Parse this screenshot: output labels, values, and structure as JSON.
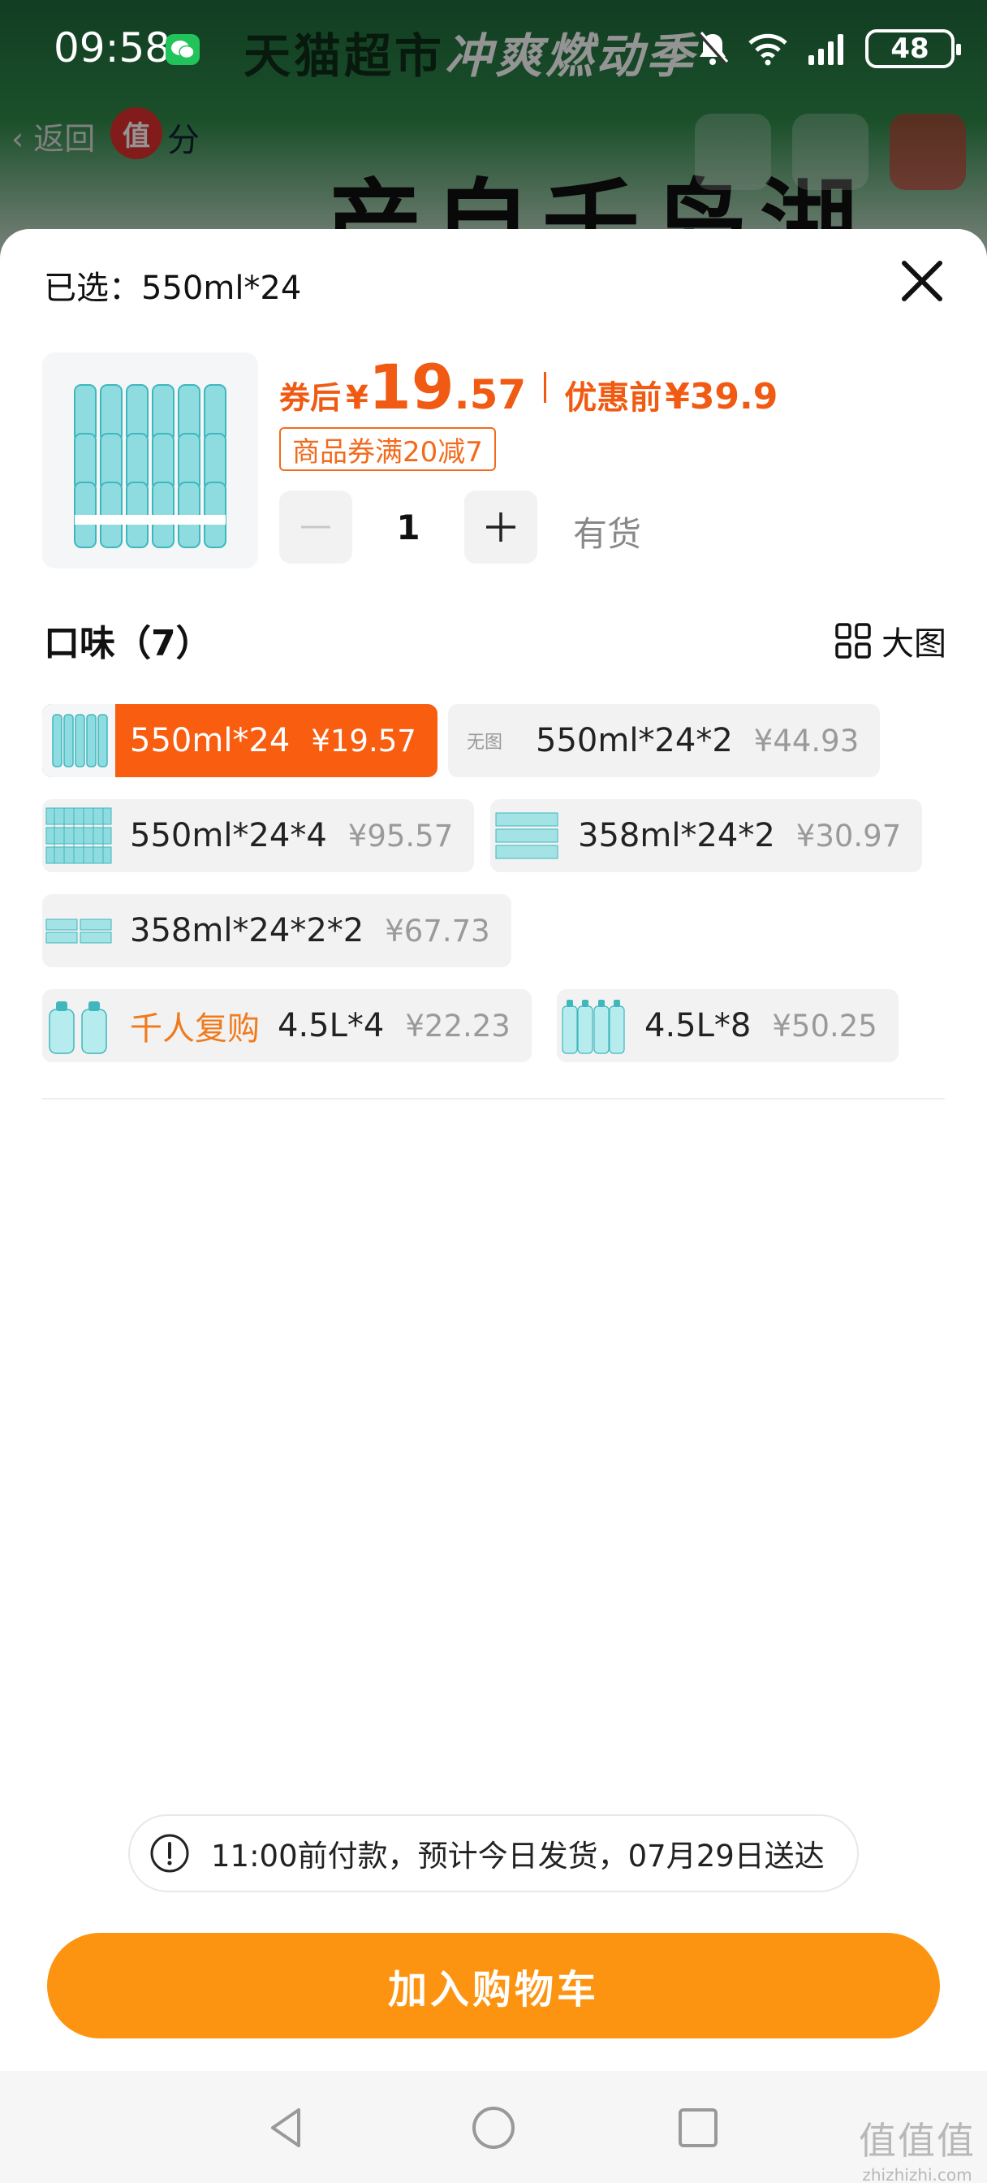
{
  "status_bar": {
    "time": "09:58",
    "battery": "48"
  },
  "background": {
    "banner": "天猫超市",
    "banner_emphasis": "冲爽燃动季",
    "back_label": "返回",
    "badge": "值",
    "badge_suffix": "分",
    "product_headline": "产自千岛湖"
  },
  "sheet": {
    "selected_label": "已选：",
    "selected_value": "550ml*24",
    "price": {
      "after_coupon_label": "券后",
      "currency": "¥",
      "integer": "19",
      "decimal": ".57",
      "original_label": "优惠前",
      "original_value": "¥39.9"
    },
    "coupon": "商品券满20减7",
    "quantity": "1",
    "stock_status": "有货",
    "section_title": "口味（7）",
    "big_view_label": "大图",
    "variants": [
      {
        "name": "550ml*24",
        "price": "¥19.57",
        "selected": true
      },
      {
        "name": "550ml*24*2",
        "price": "¥44.93",
        "no_image_label": "无图"
      },
      {
        "name": "550ml*24*4",
        "price": "¥95.57"
      },
      {
        "name": "358ml*24*2",
        "price": "¥30.97"
      },
      {
        "name": "358ml*24*2*2",
        "price": "¥67.73"
      },
      {
        "tag": "千人复购",
        "name": "4.5L*4",
        "price": "¥22.23"
      },
      {
        "name": "4.5L*8",
        "price": "¥50.25"
      }
    ],
    "delivery_notice": "11:00前付款，预计今日发货，07月29日送达",
    "add_to_cart": "加入购物车"
  },
  "watermark": {
    "brand": "值值值",
    "domain": "zhizhizhi.com"
  },
  "colors": {
    "accent_orange": "#f85d10",
    "price_orange": "#f05a12",
    "cart_button": "#fd9411",
    "chip_bg": "#f2f2f2"
  },
  "icons": [
    "wechat-icon",
    "mute-icon",
    "wifi-icon",
    "signal-icon",
    "close-icon",
    "minus-icon",
    "plus-icon",
    "grid-icon",
    "info-icon",
    "nav-back-icon",
    "nav-home-icon",
    "nav-recents-icon"
  ]
}
